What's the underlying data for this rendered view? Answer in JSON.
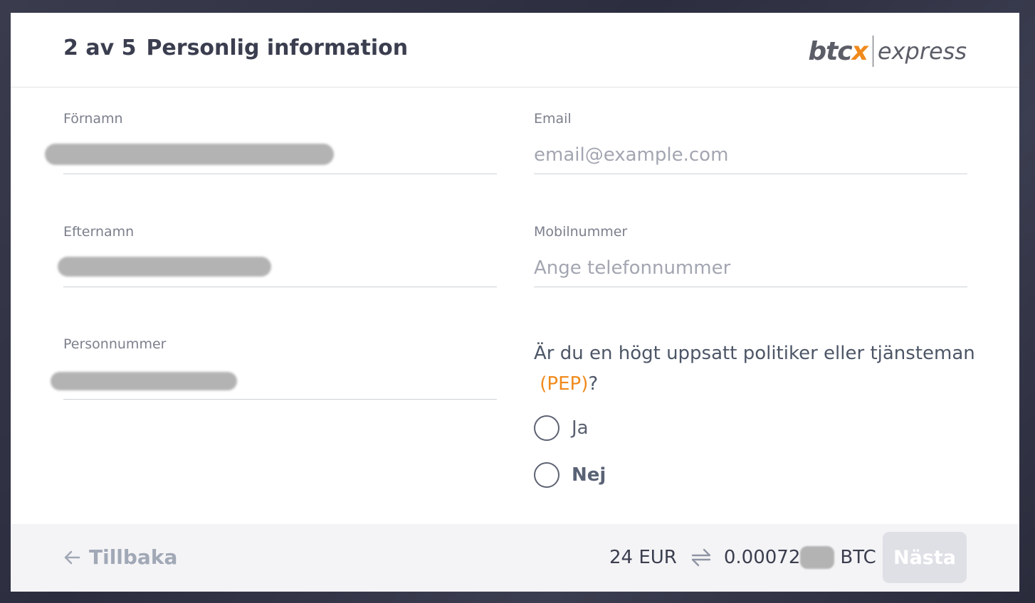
{
  "header": {
    "step": "2 av 5",
    "title": "Personlig information",
    "logo": {
      "btc": "btc",
      "x": "x",
      "express": "express"
    }
  },
  "form": {
    "first_name": {
      "label": "Förnamn",
      "value": ""
    },
    "last_name": {
      "label": "Efternamn",
      "value": ""
    },
    "personal_number": {
      "label": "Personnummer",
      "value": ""
    },
    "email": {
      "label": "Email",
      "placeholder": "email@example.com",
      "value": ""
    },
    "mobile": {
      "label": "Mobilnummer",
      "placeholder": "Ange telefonnummer",
      "value": ""
    }
  },
  "pep": {
    "question": "Är du en högt uppsatt politiker eller tjänsteman",
    "link": "(PEP)",
    "question_end": "?",
    "options": [
      {
        "label": "Ja"
      },
      {
        "label": "Nej"
      }
    ]
  },
  "footer": {
    "back_label": "Tillbaka",
    "amount_fiat": "24 EUR",
    "amount_btc": "0.00072",
    "btc_unit": "BTC",
    "next_label": "Nästa"
  },
  "colors": {
    "accent": "#f08a1c",
    "title": "#3b3e4f",
    "disabled_button": "#dfe0e6"
  }
}
